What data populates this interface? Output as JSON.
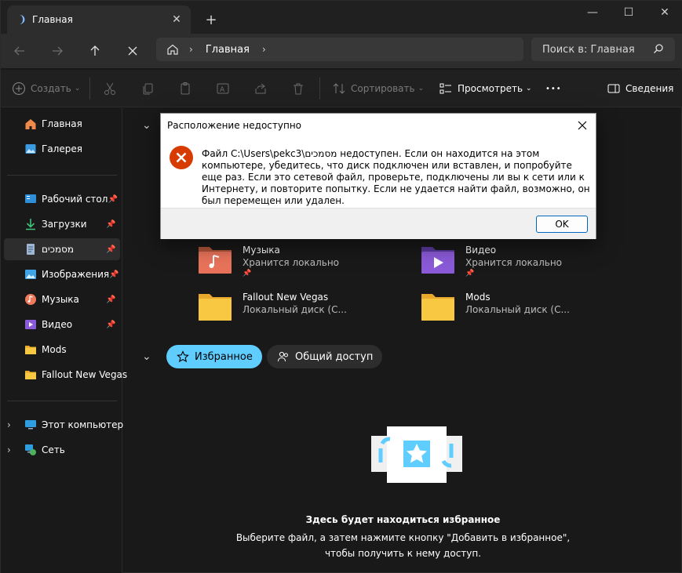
{
  "tabbar": {
    "tab_title": "Главная",
    "new_tab_glyph": "+",
    "minimize_glyph": "—",
    "maximize_glyph": "☐",
    "close_glyph": "✕"
  },
  "nav": {
    "address_crumb": "Главная",
    "search_placeholder": "Поиск в: Главная"
  },
  "toolbar": {
    "create_label": "Создать",
    "sort_label": "Сортировать",
    "view_label": "Просмотреть",
    "more_glyph": "•••",
    "details_label": "Сведения"
  },
  "sidebar": {
    "items": [
      {
        "label": "Главная",
        "icon": "home-icon"
      },
      {
        "label": "Галерея",
        "icon": "gallery-icon"
      },
      {
        "label": "Рабочий стол",
        "icon": "desktop-icon",
        "pinned": true
      },
      {
        "label": "Загрузки",
        "icon": "download-icon",
        "pinned": true
      },
      {
        "label": "מסמכים",
        "icon": "documents-icon",
        "pinned": true
      },
      {
        "label": "Изображения",
        "icon": "pictures-icon",
        "pinned": true
      },
      {
        "label": "Музыка",
        "icon": "music-icon",
        "pinned": true
      },
      {
        "label": "Видео",
        "icon": "video-icon",
        "pinned": true
      },
      {
        "label": "Mods",
        "icon": "folder-icon"
      },
      {
        "label": "Fallout New Vegas",
        "icon": "folder-icon"
      },
      {
        "label": "Этот компьютер",
        "icon": "computer-icon"
      },
      {
        "label": "Сеть",
        "icon": "network-icon"
      }
    ]
  },
  "quick_access": [
    {
      "name": "Музыка",
      "sub": "Хранится локально"
    },
    {
      "name": "Видео",
      "sub": "Хранится локально"
    },
    {
      "name": "Fallout New Vegas",
      "sub": "Локальный диск (C..."
    },
    {
      "name": "Mods",
      "sub": "Локальный диск (C..."
    }
  ],
  "favorites": {
    "tab_favorites": "Избранное",
    "tab_shared": "Общий доступ",
    "empty_title": "Здесь будет находиться избранное",
    "empty_line1": "Выберите файл, а затем нажмите кнопку \"Добавить в избранное\",",
    "empty_line2": "чтобы получить к нему доступ."
  },
  "dialog": {
    "title": "Расположение недоступно",
    "message": "Файл C:\\Users\\pekc3\\מסמכים недоступен. Если он находится на этом компьютере, убедитесь, что диск подключен или вставлен, и попробуйте еще раз. Если это сетевой файл, проверьте, подключены ли вы к сети или к Интернету, и повторите попытку. Если не удается найти файл, возможно, он был перемещен или удален.",
    "ok_label": "OK"
  },
  "colors": {
    "accent": "#60cdff",
    "error": "#d83b01",
    "folder": "#f8c843"
  }
}
